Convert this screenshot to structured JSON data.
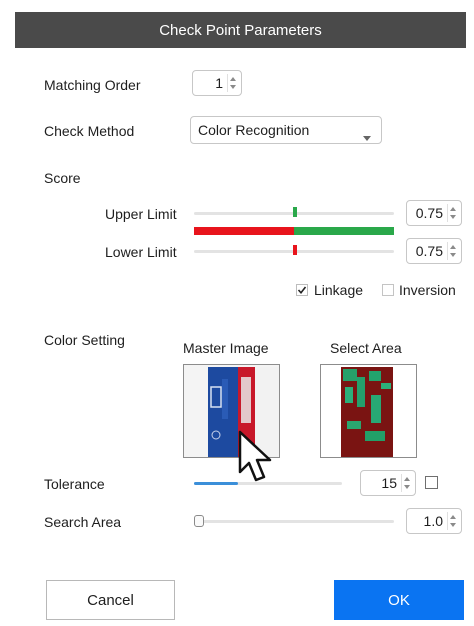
{
  "dialog": {
    "title": "Check Point Parameters",
    "matching_order": {
      "label": "Matching Order",
      "value": "1"
    },
    "check_method": {
      "label": "Check Method",
      "value": "Color Recognition"
    },
    "score": {
      "label": "Score",
      "upper_limit": {
        "label": "Upper Limit",
        "value": "0.75"
      },
      "lower_limit": {
        "label": "Lower Limit",
        "value": "0.75"
      }
    },
    "linkage": {
      "label": "Linkage",
      "checked": true
    },
    "inversion": {
      "label": "Inversion",
      "checked": false
    },
    "color_setting": {
      "label": "Color Setting",
      "master_image_label": "Master Image",
      "select_area_label": "Select Area"
    },
    "tolerance": {
      "label": "Tolerance",
      "value": "15",
      "slider_fraction": 0.3,
      "checked": false
    },
    "search_area": {
      "label": "Search Area",
      "value": "1.0",
      "slider_fraction": 0.0
    },
    "buttons": {
      "cancel": "Cancel",
      "ok": "OK"
    },
    "colors": {
      "title_bar": "#4a4a4a",
      "score_low": "#e8141c",
      "score_high": "#2aa84a",
      "slider_fill": "#3b8fd9",
      "ok_button": "#0a74f2"
    },
    "icons": [
      "chevron-down-icon",
      "checkmark-icon",
      "pointer-cursor-icon",
      "spinner-arrows-icon"
    ]
  }
}
